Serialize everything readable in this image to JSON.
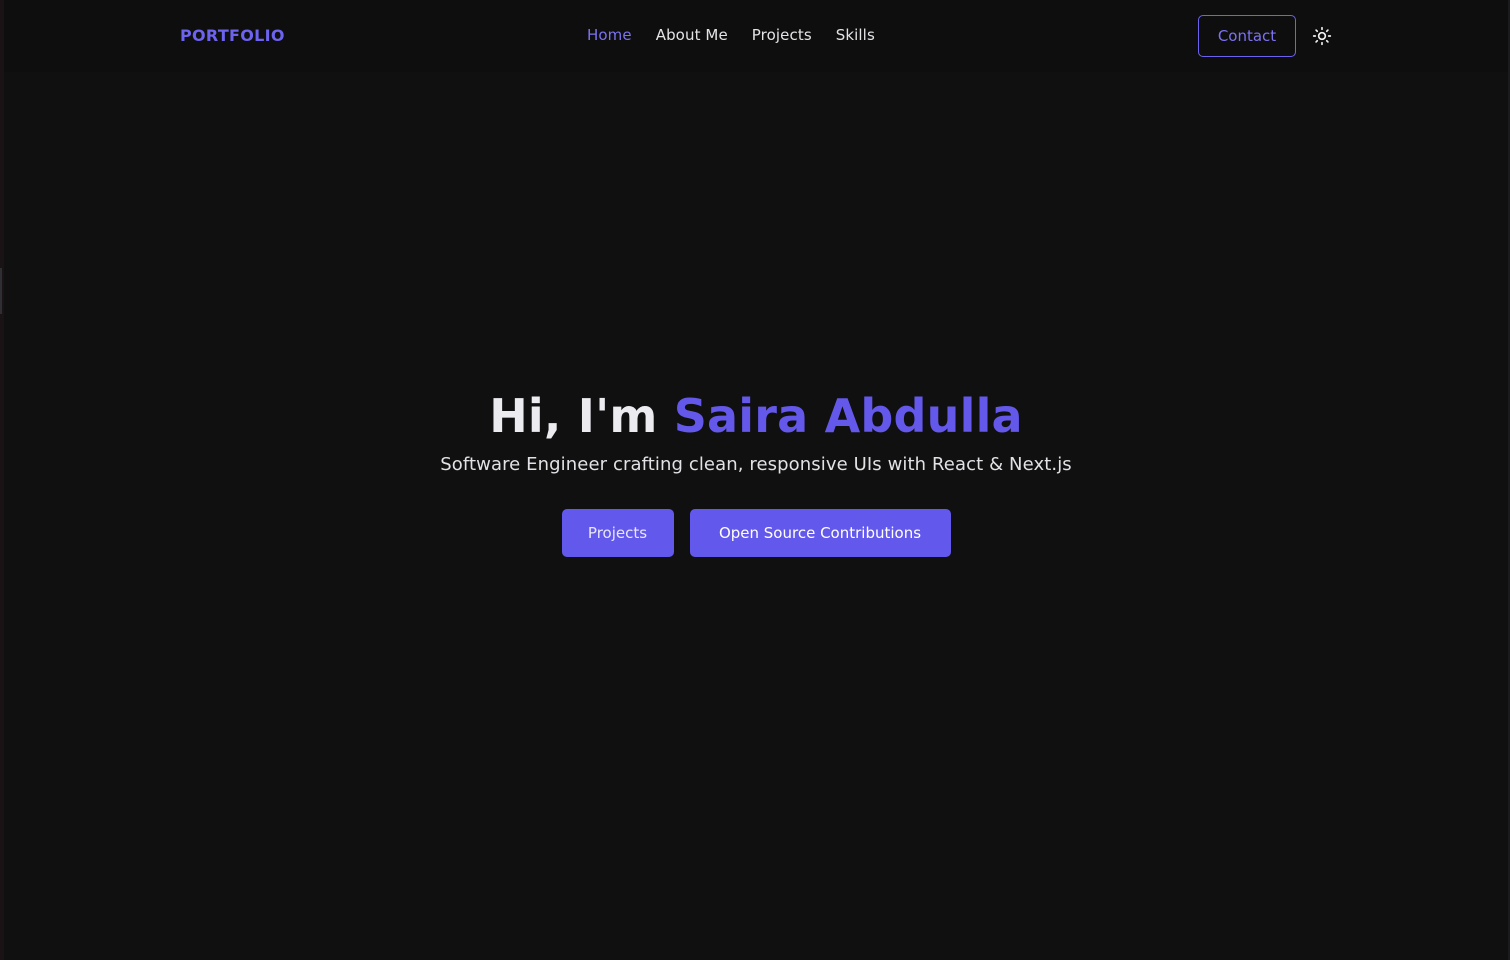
{
  "navbar": {
    "logo": "PORTFOLIO",
    "links": [
      {
        "label": "Home",
        "active": true
      },
      {
        "label": "About Me",
        "active": false
      },
      {
        "label": "Projects",
        "active": false
      },
      {
        "label": "Skills",
        "active": false
      }
    ],
    "contact_label": "Contact",
    "theme_icon": "sun-icon"
  },
  "hero": {
    "greeting": "Hi, I'm ",
    "name": "Saira Abdulla",
    "subtitle": "Software Engineer crafting clean, responsive UIs with React & Next.js",
    "primary_button": "Projects",
    "secondary_button": "Open Source Contributions"
  },
  "colors": {
    "background": "#101011",
    "accent": "#6358ea",
    "text": "#ececf0"
  }
}
